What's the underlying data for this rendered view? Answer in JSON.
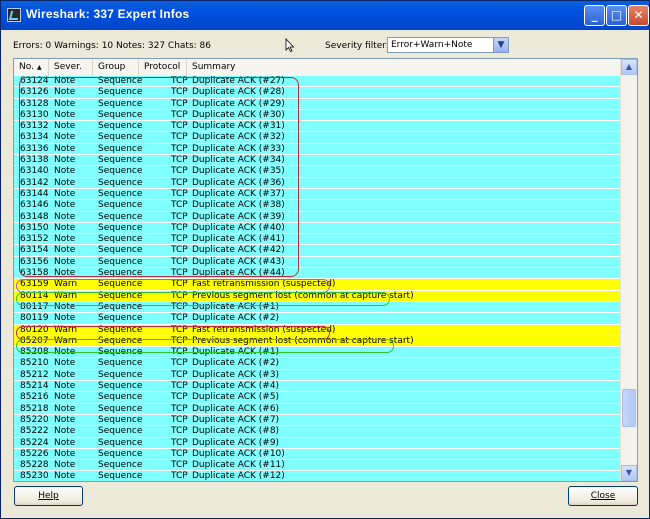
{
  "window": {
    "title": "Wireshark: 337 Expert Infos",
    "minimize": "_",
    "maximize": "□",
    "close": "✕"
  },
  "stats": "Errors: 0 Warnings: 10 Notes: 327 Chats: 86",
  "severity_filter": {
    "label": "Severity filter:",
    "value": "Error+Warn+Note"
  },
  "columns": [
    "No.",
    "Sever.",
    "Group",
    "Protocol",
    "Summary"
  ],
  "rows": [
    {
      "no": "63124",
      "sev": "Note",
      "group": "Sequence",
      "proto": "TCP",
      "summary": "Duplicate ACK (#27)"
    },
    {
      "no": "63126",
      "sev": "Note",
      "group": "Sequence",
      "proto": "TCP",
      "summary": "Duplicate ACK (#28)"
    },
    {
      "no": "63128",
      "sev": "Note",
      "group": "Sequence",
      "proto": "TCP",
      "summary": "Duplicate ACK (#29)"
    },
    {
      "no": "63130",
      "sev": "Note",
      "group": "Sequence",
      "proto": "TCP",
      "summary": "Duplicate ACK (#30)"
    },
    {
      "no": "63132",
      "sev": "Note",
      "group": "Sequence",
      "proto": "TCP",
      "summary": "Duplicate ACK (#31)"
    },
    {
      "no": "63134",
      "sev": "Note",
      "group": "Sequence",
      "proto": "TCP",
      "summary": "Duplicate ACK (#32)"
    },
    {
      "no": "63136",
      "sev": "Note",
      "group": "Sequence",
      "proto": "TCP",
      "summary": "Duplicate ACK (#33)"
    },
    {
      "no": "63138",
      "sev": "Note",
      "group": "Sequence",
      "proto": "TCP",
      "summary": "Duplicate ACK (#34)"
    },
    {
      "no": "63140",
      "sev": "Note",
      "group": "Sequence",
      "proto": "TCP",
      "summary": "Duplicate ACK (#35)"
    },
    {
      "no": "63142",
      "sev": "Note",
      "group": "Sequence",
      "proto": "TCP",
      "summary": "Duplicate ACK (#36)"
    },
    {
      "no": "63144",
      "sev": "Note",
      "group": "Sequence",
      "proto": "TCP",
      "summary": "Duplicate ACK (#37)"
    },
    {
      "no": "63146",
      "sev": "Note",
      "group": "Sequence",
      "proto": "TCP",
      "summary": "Duplicate ACK (#38)"
    },
    {
      "no": "63148",
      "sev": "Note",
      "group": "Sequence",
      "proto": "TCP",
      "summary": "Duplicate ACK (#39)"
    },
    {
      "no": "63150",
      "sev": "Note",
      "group": "Sequence",
      "proto": "TCP",
      "summary": "Duplicate ACK (#40)"
    },
    {
      "no": "63152",
      "sev": "Note",
      "group": "Sequence",
      "proto": "TCP",
      "summary": "Duplicate ACK (#41)"
    },
    {
      "no": "63154",
      "sev": "Note",
      "group": "Sequence",
      "proto": "TCP",
      "summary": "Duplicate ACK (#42)"
    },
    {
      "no": "63156",
      "sev": "Note",
      "group": "Sequence",
      "proto": "TCP",
      "summary": "Duplicate ACK (#43)"
    },
    {
      "no": "63158",
      "sev": "Note",
      "group": "Sequence",
      "proto": "TCP",
      "summary": "Duplicate ACK (#44)"
    },
    {
      "no": "63159",
      "sev": "Warn",
      "group": "Sequence",
      "proto": "TCP",
      "summary": "Fast retransmission (suspected)"
    },
    {
      "no": "80114",
      "sev": "Warn",
      "group": "Sequence",
      "proto": "TCP",
      "summary": "Previous segment lost (common at capture start)"
    },
    {
      "no": "80117",
      "sev": "Note",
      "group": "Sequence",
      "proto": "TCP",
      "summary": "Duplicate ACK (#1)"
    },
    {
      "no": "80119",
      "sev": "Note",
      "group": "Sequence",
      "proto": "TCP",
      "summary": "Duplicate ACK (#2)"
    },
    {
      "no": "80120",
      "sev": "Warn",
      "group": "Sequence",
      "proto": "TCP",
      "summary": "Fast retransmission (suspected)"
    },
    {
      "no": "85207",
      "sev": "Warn",
      "group": "Sequence",
      "proto": "TCP",
      "summary": "Previous segment lost (common at capture start)"
    },
    {
      "no": "85208",
      "sev": "Note",
      "group": "Sequence",
      "proto": "TCP",
      "summary": "Duplicate ACK (#1)"
    },
    {
      "no": "85210",
      "sev": "Note",
      "group": "Sequence",
      "proto": "TCP",
      "summary": "Duplicate ACK (#2)"
    },
    {
      "no": "85212",
      "sev": "Note",
      "group": "Sequence",
      "proto": "TCP",
      "summary": "Duplicate ACK (#3)"
    },
    {
      "no": "85214",
      "sev": "Note",
      "group": "Sequence",
      "proto": "TCP",
      "summary": "Duplicate ACK (#4)"
    },
    {
      "no": "85216",
      "sev": "Note",
      "group": "Sequence",
      "proto": "TCP",
      "summary": "Duplicate ACK (#5)"
    },
    {
      "no": "85218",
      "sev": "Note",
      "group": "Sequence",
      "proto": "TCP",
      "summary": "Duplicate ACK (#6)"
    },
    {
      "no": "85220",
      "sev": "Note",
      "group": "Sequence",
      "proto": "TCP",
      "summary": "Duplicate ACK (#7)"
    },
    {
      "no": "85222",
      "sev": "Note",
      "group": "Sequence",
      "proto": "TCP",
      "summary": "Duplicate ACK (#8)"
    },
    {
      "no": "85224",
      "sev": "Note",
      "group": "Sequence",
      "proto": "TCP",
      "summary": "Duplicate ACK (#9)"
    },
    {
      "no": "85226",
      "sev": "Note",
      "group": "Sequence",
      "proto": "TCP",
      "summary": "Duplicate ACK (#10)"
    },
    {
      "no": "85228",
      "sev": "Note",
      "group": "Sequence",
      "proto": "TCP",
      "summary": "Duplicate ACK (#11)"
    },
    {
      "no": "85230",
      "sev": "Note",
      "group": "Sequence",
      "proto": "TCP",
      "summary": "Duplicate ACK (#12)"
    }
  ],
  "colors": {
    "note_row": "#80ffff",
    "warn_row": "#ffff00"
  },
  "buttons": {
    "help": "Help",
    "close": "Close"
  }
}
